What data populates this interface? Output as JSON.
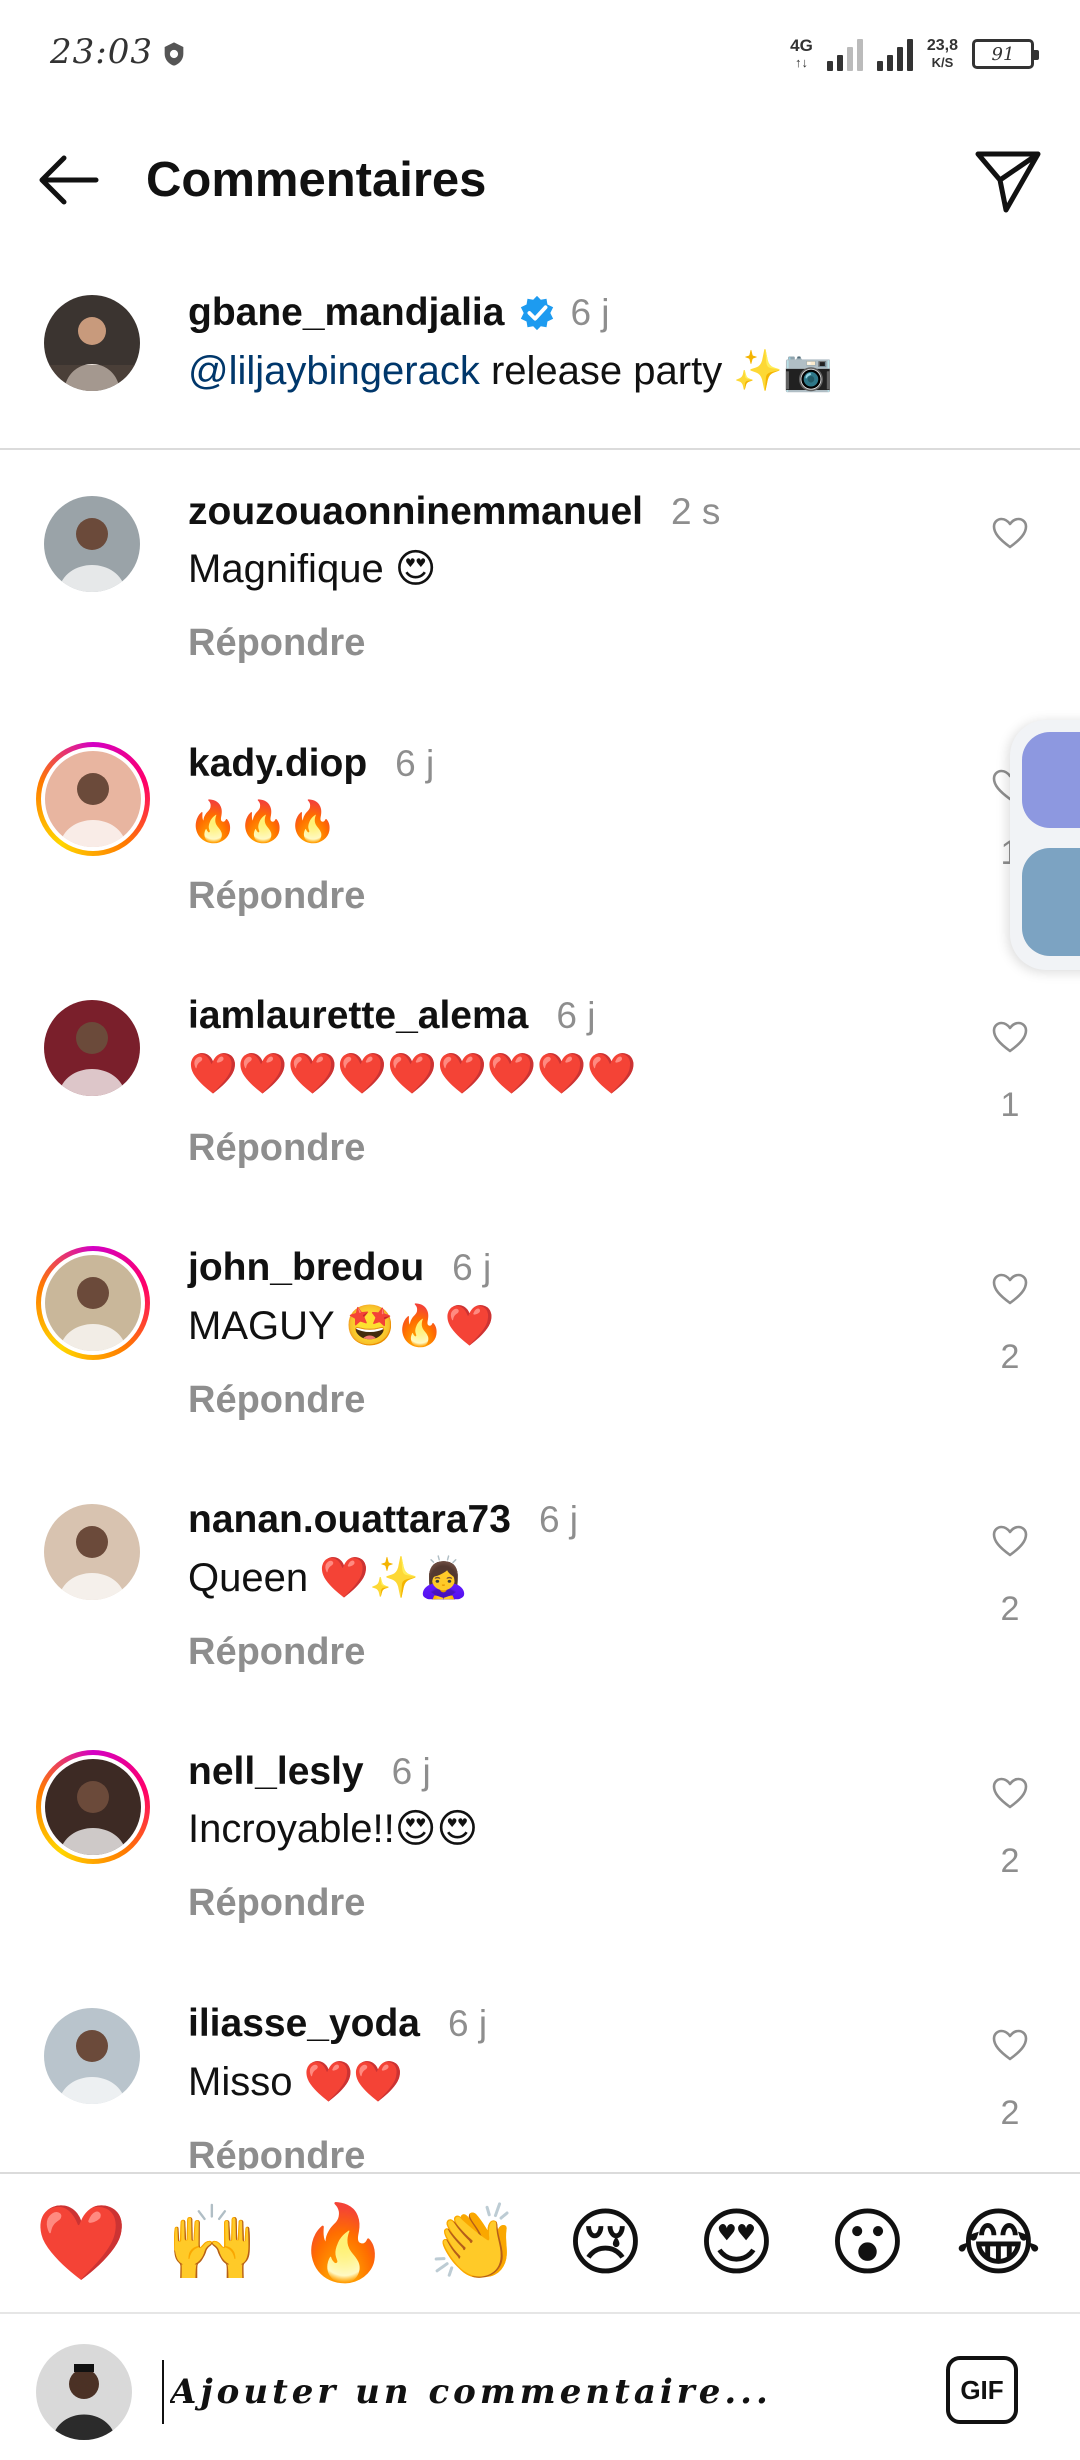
{
  "status_bar": {
    "time": "23:03",
    "network": "4G",
    "speed_value": "23,8",
    "speed_unit": "K/S",
    "battery": "91"
  },
  "header": {
    "title": "Commentaires"
  },
  "caption": {
    "username": "gbane_mandjalia",
    "time": "6 j",
    "mention": "@liljaybingerack",
    "text": " release party ✨📷"
  },
  "reply_label": "Répondre",
  "comments": [
    {
      "username": "zouzouaonninemmanuel",
      "time": "2 s",
      "text": "Magnifique 😍",
      "likes": "",
      "story_ring": false,
      "avatar_color": "#9aa3a8"
    },
    {
      "username": "kady.diop",
      "time": "6 j",
      "text": "🔥🔥🔥",
      "likes": "1",
      "story_ring": true,
      "avatar_color": "#e8b5a0"
    },
    {
      "username": "iamlaurette_alema",
      "time": "6 j",
      "text": "❤️❤️❤️❤️❤️❤️❤️❤️❤️",
      "likes": "1",
      "story_ring": false,
      "avatar_color": "#7a1f2b"
    },
    {
      "username": "john_bredou",
      "time": "6 j",
      "text": "MAGUY 🤩🔥❤️",
      "likes": "2",
      "story_ring": true,
      "avatar_color": "#c9b79a"
    },
    {
      "username": "nanan.ouattara73",
      "time": "6 j",
      "text": "Queen ❤️✨🙇‍♀️",
      "likes": "2",
      "story_ring": false,
      "avatar_color": "#d8c3b0"
    },
    {
      "username": "nell_lesly",
      "time": "6 j",
      "text": "Incroyable!!😍😍",
      "likes": "2",
      "story_ring": true,
      "avatar_color": "#3d2a24"
    },
    {
      "username": "iliasse_yoda",
      "time": "6 j",
      "text": "Misso ❤️❤️",
      "likes": "2",
      "story_ring": false,
      "avatar_color": "#b9c4cc"
    }
  ],
  "emoji_bar": [
    "❤️",
    "🙌",
    "🔥",
    "👏",
    "😢",
    "😍",
    "😮",
    "😂"
  ],
  "composer": {
    "placeholder": "Ajouter un commentaire...",
    "gif_label": "GIF"
  }
}
